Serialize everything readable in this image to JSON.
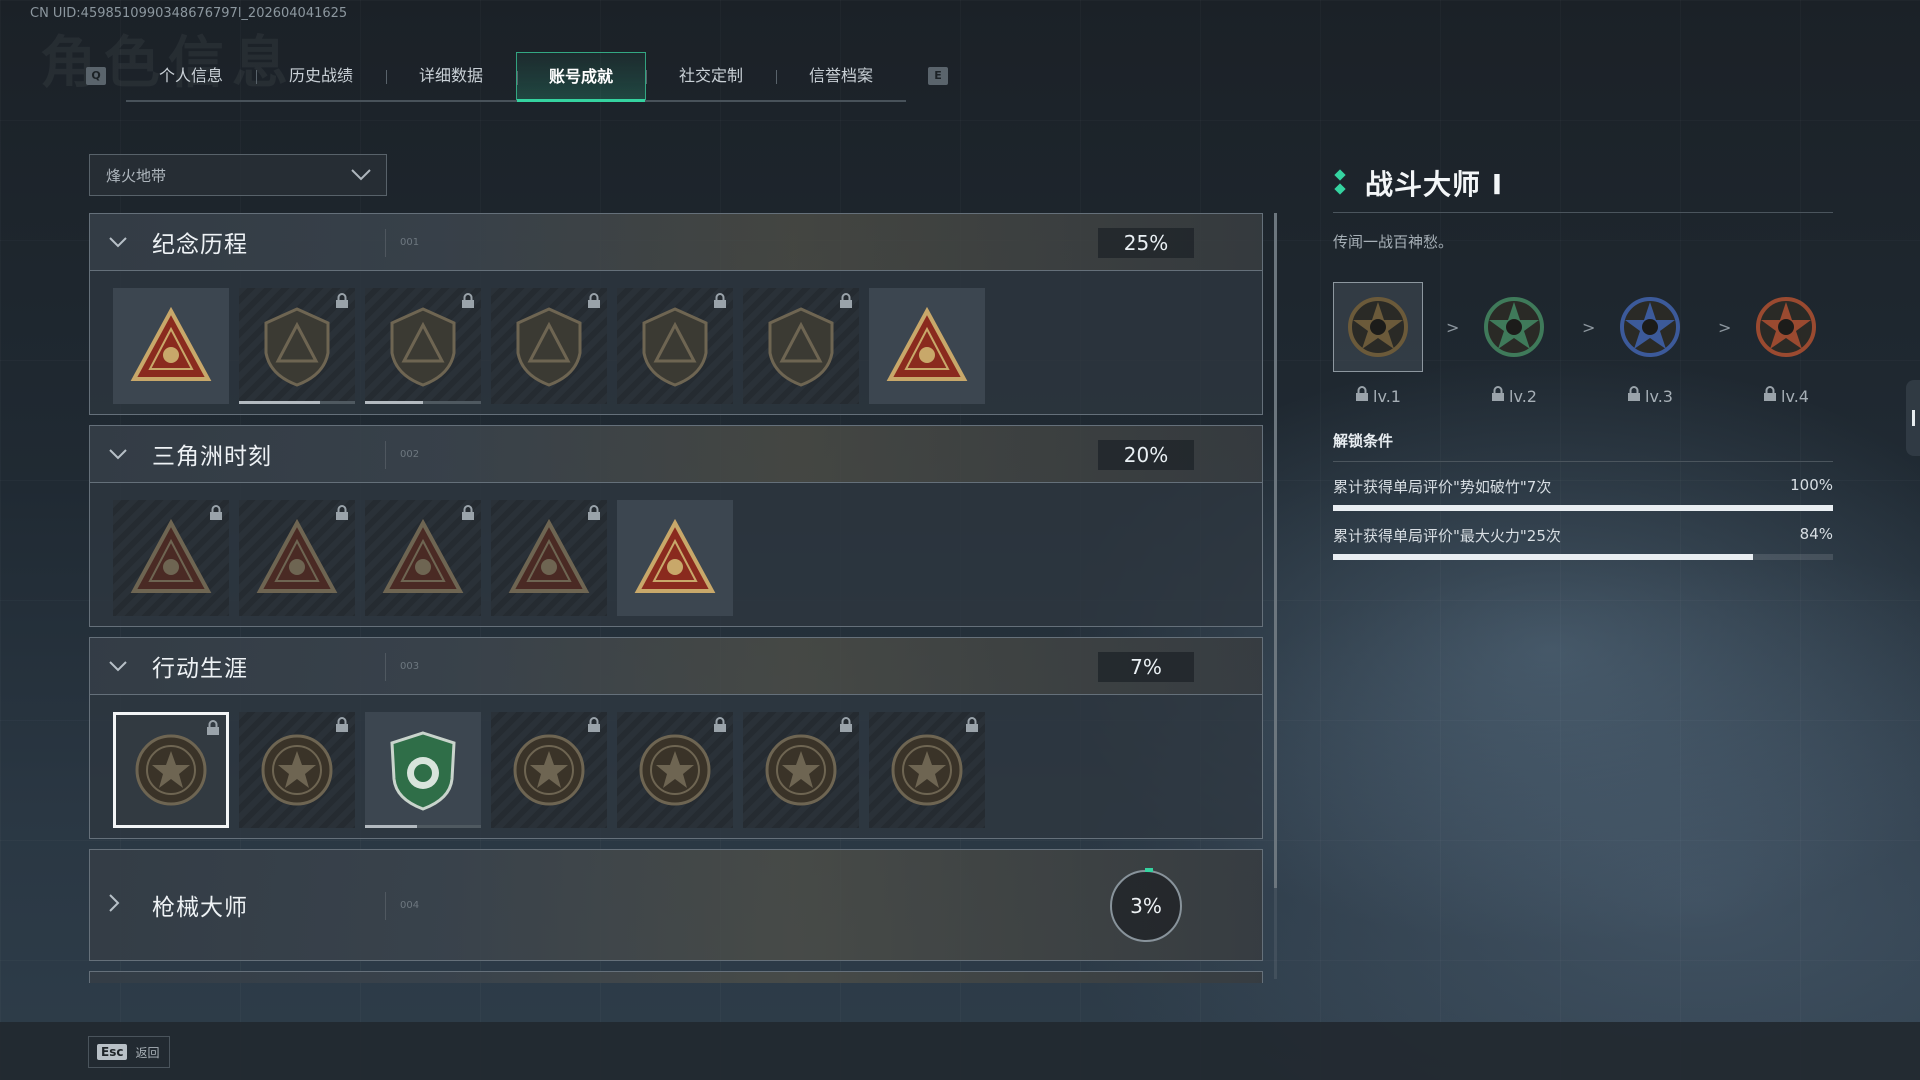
{
  "uid_text": "CN UID:4598510990348676797l_202604041625",
  "tabs": {
    "left_key": "Q",
    "right_key": "E",
    "items": [
      {
        "label": "个人信息"
      },
      {
        "label": "历史战绩"
      },
      {
        "label": "详细数据"
      },
      {
        "label": "账号成就"
      },
      {
        "label": "社交定制"
      },
      {
        "label": "信誉档案"
      }
    ],
    "active_index": 3
  },
  "dropdown": {
    "value": "烽火地带"
  },
  "groups": [
    {
      "title": "纪念历程",
      "code": "001",
      "percent": "25%",
      "badges": [
        {
          "icon": "delta-triangle-emblem-icon",
          "locked": false
        },
        {
          "icon": "helicopter-emblem-icon",
          "locked": true,
          "progress": 0.7
        },
        {
          "icon": "shield-diamond-emblem-icon",
          "locked": true,
          "progress": 0.5
        },
        {
          "icon": "bunker-58-emblem-icon",
          "locked": true
        },
        {
          "icon": "hooded-operator-emblem-icon",
          "locked": true
        },
        {
          "icon": "crossed-rifles-skull-emblem-icon",
          "locked": true
        },
        {
          "icon": "number-one-triangle-emblem-icon",
          "locked": false
        }
      ]
    },
    {
      "title": "三角洲时刻",
      "code": "002",
      "percent": "20%",
      "badges": [
        {
          "icon": "backpack-triangle-emblem-icon",
          "locked": true
        },
        {
          "icon": "skull-triangle-emblem-icon",
          "locked": true
        },
        {
          "icon": "kneeling-soldier-triangle-emblem-icon",
          "locked": true
        },
        {
          "icon": "hexagon-target-triangle-emblem-icon",
          "locked": true
        },
        {
          "icon": "squad-triangle-emblem-icon",
          "locked": false
        }
      ]
    },
    {
      "title": "行动生涯",
      "code": "003",
      "percent": "7%",
      "badges": [
        {
          "icon": "star-skull-medal-icon",
          "locked": true,
          "selected": true
        },
        {
          "icon": "shield-eagle-medal-icon",
          "locked": true
        },
        {
          "icon": "green-shield-medal-icon",
          "locked": false,
          "progress": 0.45
        },
        {
          "icon": "hexagram-medal-icon",
          "locked": true
        },
        {
          "icon": "helmet-medal-icon",
          "locked": true
        },
        {
          "icon": "skull-target-medal-icon",
          "locked": true
        },
        {
          "icon": "eye-medal-icon",
          "locked": true
        }
      ]
    },
    {
      "title": "枪械大师",
      "code": "004",
      "percent": "3%"
    }
  ],
  "detail": {
    "title": "战斗大师 I",
    "description": "传闻一战百神愁。",
    "levels": [
      {
        "label": "lv.1",
        "color": "#6b5a3a"
      },
      {
        "label": "lv.2",
        "color": "#3f7a5a"
      },
      {
        "label": "lv.3",
        "color": "#3c5a9a"
      },
      {
        "label": "lv.4",
        "color": "#9a4a30"
      }
    ],
    "arrow": ">",
    "conditions_title": "解锁条件",
    "conditions": [
      {
        "text": "累计获得单局评价\"势如破竹\"7次",
        "percent_label": "100%",
        "percent": 100
      },
      {
        "text": "累计获得单局评价\"最大火力\"25次",
        "percent_label": "84%",
        "percent": 84
      }
    ]
  },
  "footer": {
    "key": "Esc",
    "label": "返回"
  },
  "colors": {
    "accent": "#35d3a0"
  }
}
